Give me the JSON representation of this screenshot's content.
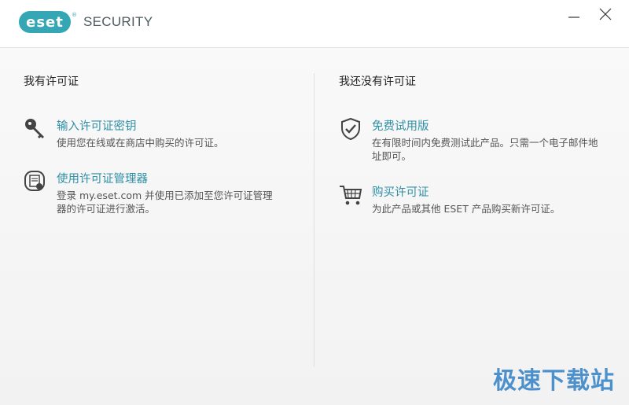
{
  "window": {
    "logo_mark": "eset",
    "logo_reg": "®",
    "product_name": "SECURITY",
    "minimize_icon": "minimize-icon",
    "close_icon": "close-icon"
  },
  "left": {
    "title": "我有许可证",
    "options": [
      {
        "icon": "key-icon",
        "title": "输入许可证密钥",
        "description": "使用您在线或在商店中购买的许可证。"
      },
      {
        "icon": "license-manager-icon",
        "title": "使用许可证管理器",
        "description": "登录 my.eset.com 并使用已添加至您许可证管理器的许可证进行激活。"
      }
    ]
  },
  "right": {
    "title": "我还没有许可证",
    "options": [
      {
        "icon": "shield-check-icon",
        "title": "免费试用版",
        "description": "在有限时间内免费测试此产品。只需一个电子邮件地址即可。"
      },
      {
        "icon": "shopping-cart-icon",
        "title": "购买许可证",
        "description": "为此产品或其他 ESET 产品购买新许可证。"
      }
    ]
  },
  "watermark": "极速下载站",
  "colors": {
    "accent": "#35a6b4",
    "link": "#2e8fa6",
    "watermark": "#2f7fc6"
  }
}
